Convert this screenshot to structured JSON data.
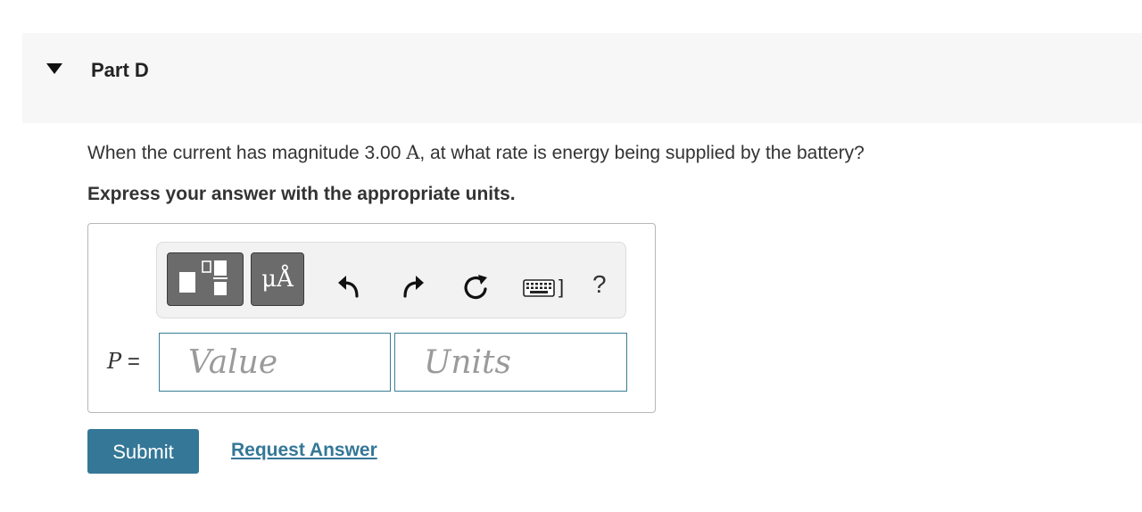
{
  "part": {
    "title": "Part D",
    "collapse_icon": "caret-down-icon"
  },
  "question": {
    "text_before": "When the current has magnitude 3.00 ",
    "unit": "A",
    "text_after": ", at what rate is energy being supplied by the battery?",
    "instruction": "Express your answer with the appropriate units."
  },
  "toolbar": {
    "template_icon": "fraction-template-icon",
    "units_label": "μÅ",
    "undo_icon": "undo-icon",
    "redo_icon": "redo-icon",
    "reset_icon": "reset-icon",
    "keyboard_icon": "keyboard-icon",
    "keyboard_suffix": "]",
    "help_label": "?"
  },
  "answer": {
    "variable": "P",
    "equals": "=",
    "value_placeholder": "Value",
    "value": "",
    "units_placeholder": "Units",
    "units": ""
  },
  "actions": {
    "submit_label": "Submit",
    "request_label": "Request Answer"
  },
  "colors": {
    "accent": "#347797",
    "input_border": "#3c7d96",
    "header_bg": "#f7f7f7",
    "toolbar_bg": "#f2f2f2",
    "toolbar_button": "#6b6b6b"
  }
}
